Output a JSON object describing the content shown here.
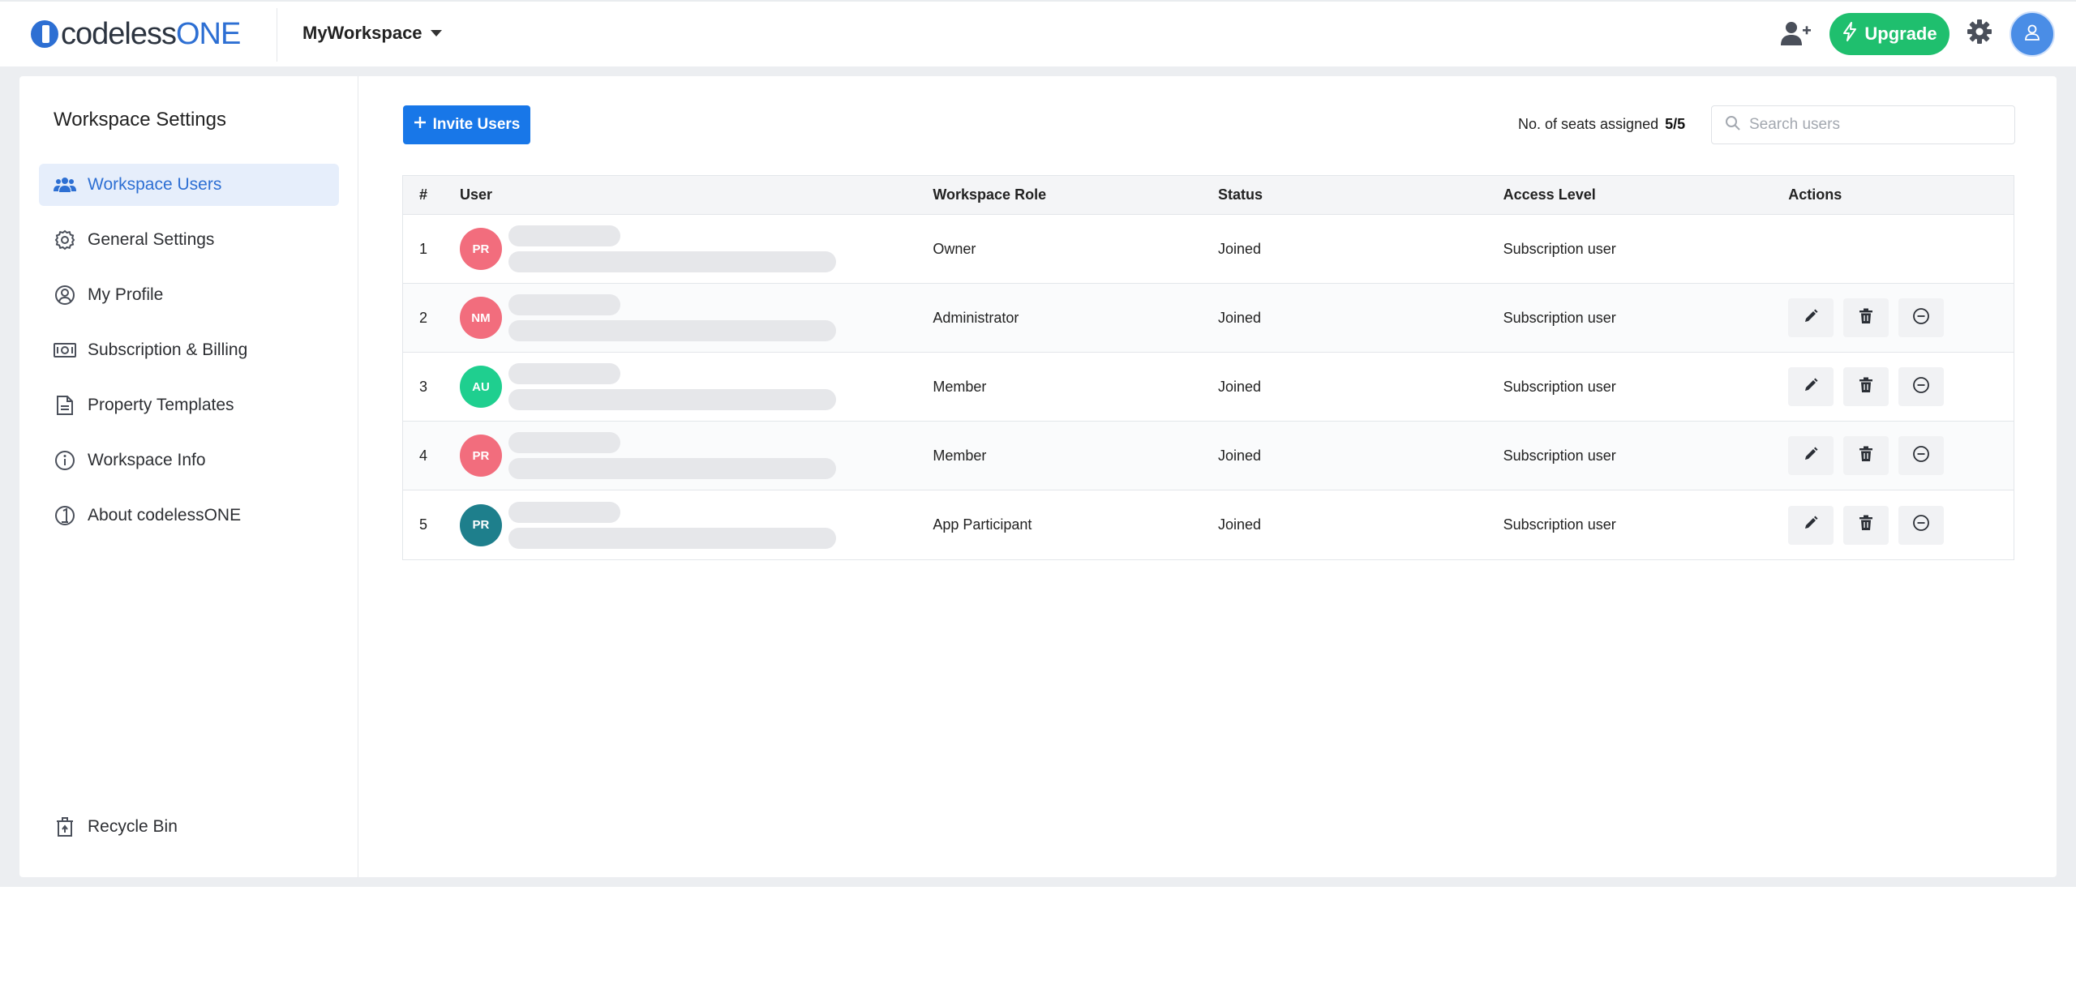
{
  "topbar": {
    "logo_part1": "codeless",
    "logo_part2": "ONE",
    "workspace_name": "MyWorkspace",
    "upgrade_label": "Upgrade"
  },
  "sidebar": {
    "title": "Workspace Settings",
    "items": [
      {
        "label": "Workspace Users",
        "icon": "users-icon",
        "active": true
      },
      {
        "label": "General Settings",
        "icon": "gear-icon"
      },
      {
        "label": "My Profile",
        "icon": "profile-icon"
      },
      {
        "label": "Subscription & Billing",
        "icon": "billing-icon"
      },
      {
        "label": "Property Templates",
        "icon": "document-icon"
      },
      {
        "label": "Workspace Info",
        "icon": "info-icon"
      },
      {
        "label": "About codelessONE",
        "icon": "codelessone-icon"
      }
    ],
    "recycle_label": "Recycle Bin"
  },
  "main": {
    "invite_label": "Invite Users",
    "seats_label": "No. of seats assigned",
    "seats_value": "5/5",
    "search_placeholder": "Search users"
  },
  "table": {
    "headers": [
      "#",
      "User",
      "Workspace Role",
      "Status",
      "Access Level",
      "Actions"
    ],
    "rows": [
      {
        "num": "1",
        "initials": "PR",
        "color": "#f26d7d",
        "role": "Owner",
        "status": "Joined",
        "access": "Subscription user",
        "has_actions": false
      },
      {
        "num": "2",
        "initials": "NM",
        "color": "#f26d7d",
        "role": "Administrator",
        "status": "Joined",
        "access": "Subscription user",
        "has_actions": true
      },
      {
        "num": "3",
        "initials": "AU",
        "color": "#1fcf8f",
        "role": "Member",
        "status": "Joined",
        "access": "Subscription user",
        "has_actions": true
      },
      {
        "num": "4",
        "initials": "PR",
        "color": "#f26d7d",
        "role": "Member",
        "status": "Joined",
        "access": "Subscription user",
        "has_actions": true
      },
      {
        "num": "5",
        "initials": "PR",
        "color": "#1e7f8c",
        "role": "App Participant",
        "status": "Joined",
        "access": "Subscription user",
        "has_actions": true
      }
    ]
  },
  "colors": {
    "brand_blue": "#2d6fd3",
    "invite_blue": "#1877e8",
    "upgrade_green": "#1fbf6e"
  }
}
